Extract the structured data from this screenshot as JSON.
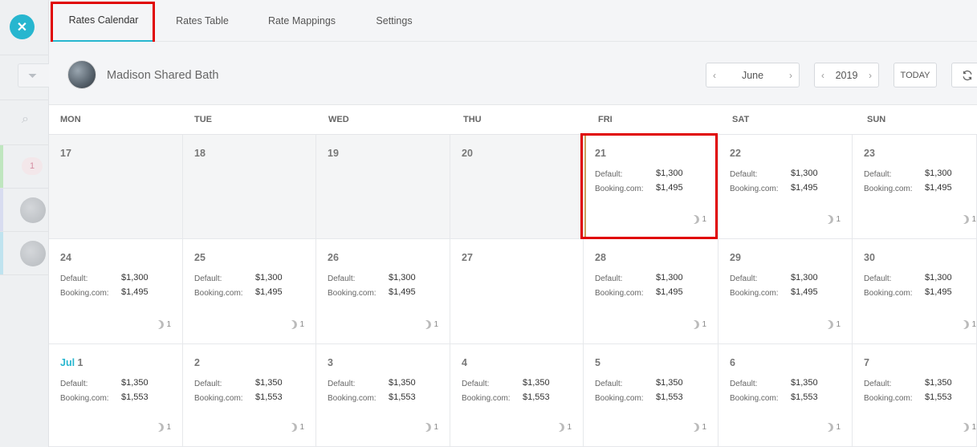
{
  "tabs": [
    "Rates Calendar",
    "Rates Table",
    "Rate Mappings",
    "Settings"
  ],
  "active_tab": "Rates Calendar",
  "property": {
    "name": "Madison Shared Bath"
  },
  "nav": {
    "month": "June",
    "year": "2019",
    "today_label": "TODAY"
  },
  "weekdays": [
    "MON",
    "TUE",
    "WED",
    "THU",
    "FRI",
    "SAT",
    "SUN"
  ],
  "labels": {
    "default": "Default:",
    "booking": "Booking.com:"
  },
  "left_panel": {
    "badge": "1"
  },
  "colors": {
    "accent": "#27b6cf",
    "highlight": "#e00000"
  },
  "weeks": [
    [
      {
        "date": "17",
        "past": true
      },
      {
        "date": "18",
        "past": true
      },
      {
        "date": "19",
        "past": true
      },
      {
        "date": "20",
        "past": true
      },
      {
        "date": "21",
        "default": "$1,300",
        "booking": "$1,495",
        "nights": "1"
      },
      {
        "date": "22",
        "default": "$1,300",
        "booking": "$1,495",
        "nights": "1"
      },
      {
        "date": "23",
        "default": "$1,300",
        "booking": "$1,495",
        "nights": "1"
      }
    ],
    [
      {
        "date": "24",
        "default": "$1,300",
        "booking": "$1,495",
        "nights": "1"
      },
      {
        "date": "25",
        "default": "$1,300",
        "booking": "$1,495",
        "nights": "1"
      },
      {
        "date": "26",
        "default": "$1,300",
        "booking": "$1,495",
        "nights": "1"
      },
      {
        "date": "27",
        "blocked": true
      },
      {
        "date": "28",
        "default": "$1,300",
        "booking": "$1,495",
        "nights": "1"
      },
      {
        "date": "29",
        "default": "$1,300",
        "booking": "$1,495",
        "nights": "1"
      },
      {
        "date": "30",
        "default": "$1,300",
        "booking": "$1,495",
        "nights": "1"
      }
    ],
    [
      {
        "month": "Jul",
        "date": "1",
        "default": "$1,350",
        "booking": "$1,553",
        "nights": "1"
      },
      {
        "date": "2",
        "default": "$1,350",
        "booking": "$1,553",
        "nights": "1"
      },
      {
        "date": "3",
        "default": "$1,350",
        "booking": "$1,553",
        "nights": "1"
      },
      {
        "date": "4",
        "default": "$1,350",
        "booking": "$1,553",
        "nights": "1"
      },
      {
        "date": "5",
        "default": "$1,350",
        "booking": "$1,553",
        "nights": "1"
      },
      {
        "date": "6",
        "default": "$1,350",
        "booking": "$1,553",
        "nights": "1"
      },
      {
        "date": "7",
        "default": "$1,350",
        "booking": "$1,553",
        "nights": "1"
      }
    ]
  ]
}
